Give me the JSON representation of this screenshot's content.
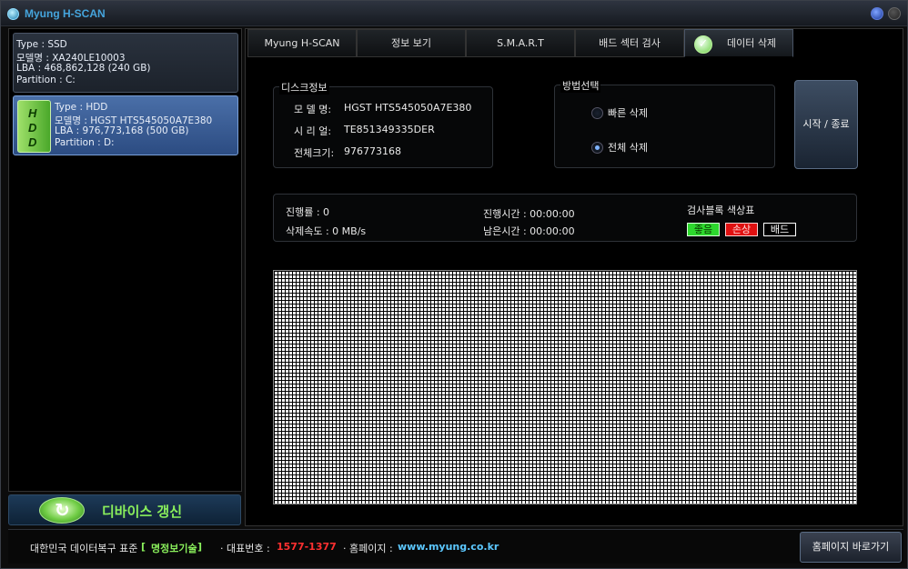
{
  "app": {
    "title": "Myung H-SCAN"
  },
  "devices": [
    {
      "type": "Type : SSD",
      "model": "모델명 : XA240LE10003",
      "lba": "LBA : 468,862,128  (240 GB)",
      "partition": "Partition : C:"
    },
    {
      "badge": [
        "H",
        "D",
        "D"
      ],
      "type": "Type : HDD",
      "model": "모델명 : HGST HTS545050A7E380",
      "lba": "LBA : 976,773,168  (500 GB)",
      "partition": "Partition : D:"
    }
  ],
  "refresh": {
    "label": "디바이스 갱신"
  },
  "tabs": [
    "Myung H-SCAN",
    "정보 보기",
    "S.M.A.R.T",
    "배드 섹터 검사",
    "데이터 삭제"
  ],
  "disk_info": {
    "title": "디스크정보",
    "model_label": "모 델 명:",
    "model_value": "HGST HTS545050A7E380",
    "serial_label": "시 리 얼:",
    "serial_value": "TE851349335DER",
    "size_label": "전체크기:",
    "size_value": "976773168"
  },
  "method": {
    "title": "방법선택",
    "options": [
      {
        "label": "빠른 삭제",
        "checked": false
      },
      {
        "label": "전체 삭제",
        "checked": true
      }
    ]
  },
  "start_button": "시작 / 종료",
  "progress": {
    "rate": "진행률 : 0",
    "speed": "삭제속도 : 0 MB/s",
    "elapsed": "진행시간 : 00:00:00",
    "remaining": "남은시간 : 00:00:00",
    "legend_title": "검사블록 색상표",
    "legend": {
      "good": "좋음",
      "warn": "손상",
      "bad": "배드"
    }
  },
  "colors": {
    "good": "#2dd82d",
    "warn": "#e01010",
    "bad": "#000000",
    "accent": "#8af05c"
  },
  "status": {
    "prefix": "대한민국 데이터복구 표준",
    "bracket_open": "[",
    "brand": "명정보기술",
    "bracket_close": "]",
    "phone_label": "· 대표번호 :",
    "phone": "1577-1377",
    "home_label": "· 홈페이지 :",
    "home": "www.myung.co.kr",
    "button": "홈페이지 바로가기"
  }
}
